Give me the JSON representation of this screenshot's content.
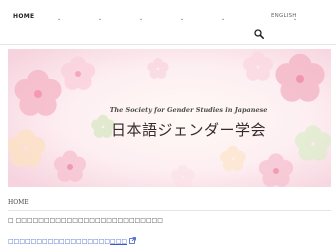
{
  "nav": {
    "home": "HOME",
    "caret": "⌄",
    "language": "ENGLISH"
  },
  "hero": {
    "subtitle": "The Society for Gender Studies in Japanese",
    "title": "日本語ジェンダー学会"
  },
  "breadcrumb": "HOME",
  "notice": "□ □□□□□□□□□□□□□□□□□□□□□□□□□□",
  "link": {
    "prefix": "□□□□□□□□□□□□□□□□□□",
    "text": "□□□"
  },
  "colors": {
    "link": "#3a5ccf",
    "hero_bg": "#fbe9ef"
  }
}
